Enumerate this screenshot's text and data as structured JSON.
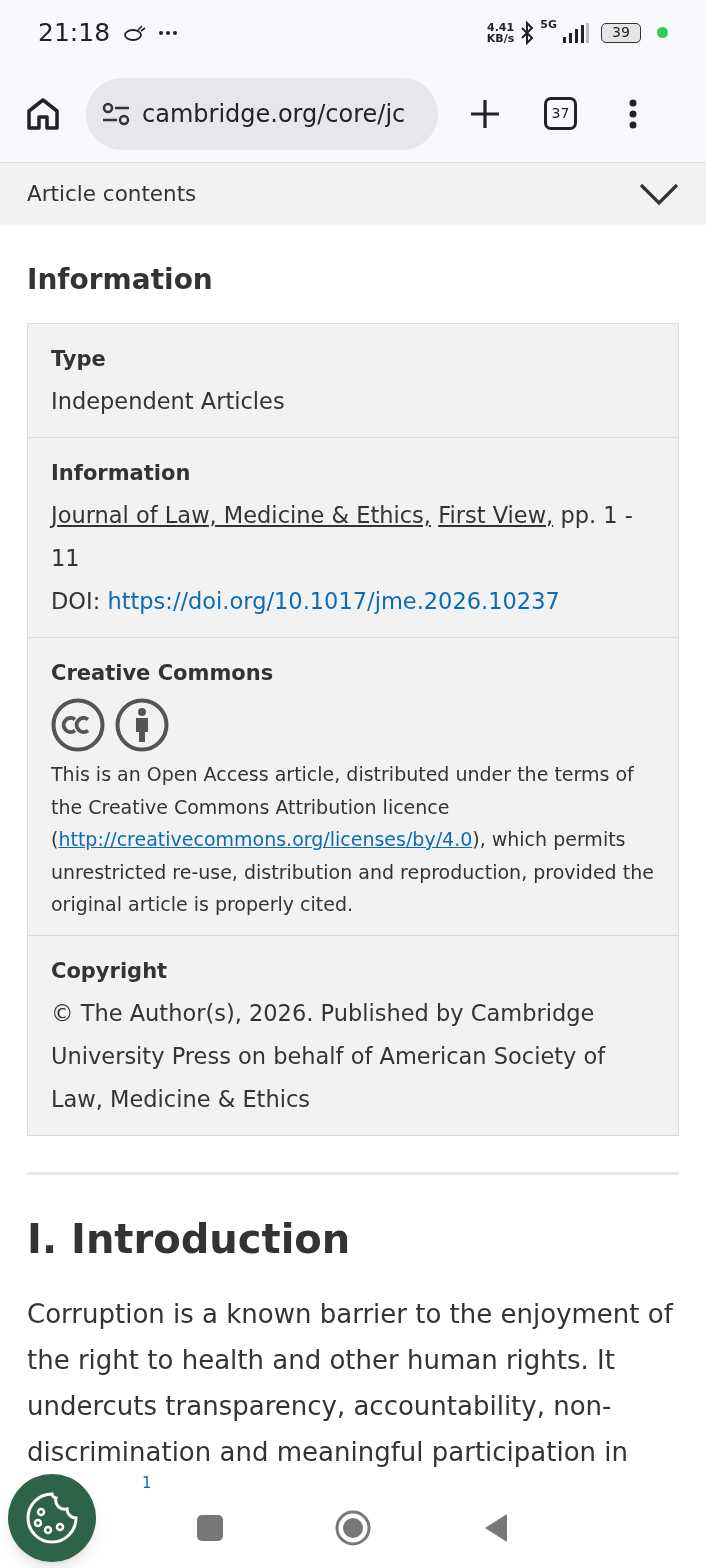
{
  "status_bar": {
    "time": "21:18",
    "speed_value": "4.41",
    "speed_unit": "KB/s",
    "network": "5G",
    "battery": "39"
  },
  "browser": {
    "url": "cambridge.org/core/jc",
    "tab_count": "37"
  },
  "article_contents": {
    "label": "Article contents",
    "expanded": false
  },
  "section_title": "Information",
  "info_rows": [
    {
      "kind": "text",
      "label": "Type",
      "text": "Independent Articles"
    },
    {
      "kind": "citation",
      "label": "Information",
      "journal": "Journal of Law, Medicine & Ethics,",
      "issue": "First View,",
      "pages": "pp. 1 - 11",
      "doi_label": "DOI:",
      "doi": "https://doi.org/10.1017/jme.2026.10237"
    },
    {
      "kind": "license",
      "label": "Creative Commons",
      "text_before": "This is an Open Access article, distributed under the terms of the Creative Commons Attribution licence (",
      "link": "http://creativecommons.org/licenses/by/4.0",
      "text_after": "), which permits unrestricted re-use, distribution and reproduction, provided the original article is properly cited."
    },
    {
      "kind": "text",
      "label": "Copyright",
      "text": "© The Author(s), 2026. Published by Cambridge University Press on behalf of American Society of Law, Medicine & Ethics"
    }
  ],
  "article": {
    "heading": "I. Introduction",
    "paragraph": "Corruption is a known barrier to the enjoyment of the right to health and other human rights. It undercuts transparency, accountability, non-discrimination and meaningful participation in",
    "footnote": "1"
  }
}
